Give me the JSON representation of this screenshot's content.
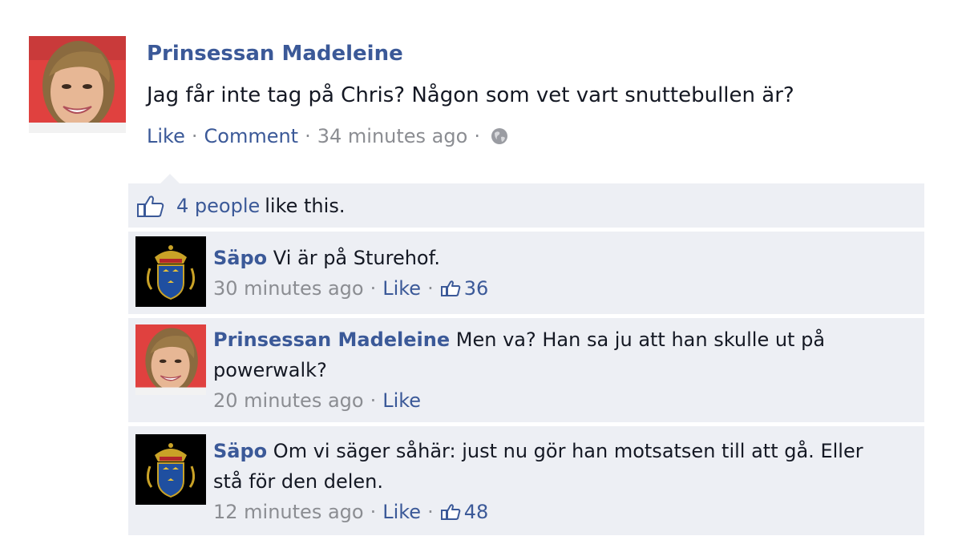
{
  "post": {
    "author": "Prinsessan Madeleine",
    "text": "Jag får inte tag på Chris? Någon som vet vart snuttebullen är?",
    "actions": {
      "like": "Like",
      "comment": "Comment",
      "time": "34 minutes ago",
      "privacy_icon": "globe-icon"
    }
  },
  "likes": {
    "count_text": "4 people",
    "suffix": "like this.",
    "icon": "thumbs-up-icon"
  },
  "comments": [
    {
      "author": "Säpo",
      "text": "Vi är på Sturehof.",
      "time": "30 minutes ago",
      "like_label": "Like",
      "like_count": "36",
      "avatar": "swedish-coat-of-arms"
    },
    {
      "author": "Prinsessan Madeleine",
      "text": "Men va? Han sa ju att han skulle ut på powerwalk?",
      "time": "20 minutes ago",
      "like_label": "Like",
      "avatar": "profile-photo"
    },
    {
      "author": "Säpo",
      "text": "Om vi säger såhär: just nu gör han motsatsen till att gå. Eller stå för den delen.",
      "time": "12 minutes ago",
      "like_label": "Like",
      "like_count": "48",
      "avatar": "swedish-coat-of-arms"
    }
  ],
  "colors": {
    "link": "#3b5998",
    "meta": "#8b8d92",
    "ufi_background": "#edeff4"
  }
}
